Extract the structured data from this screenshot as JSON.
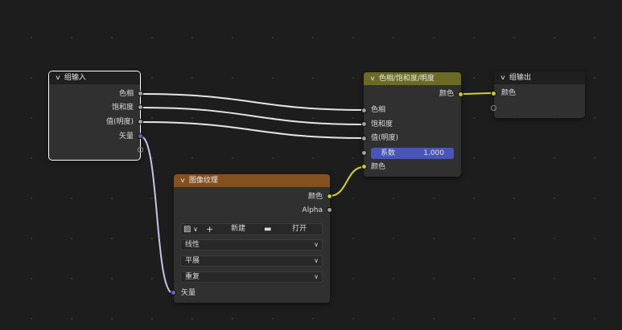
{
  "nodes": {
    "group_input": {
      "title": "组输入",
      "outputs": [
        "色相",
        "饱和度",
        "值(明度)",
        "矢量"
      ]
    },
    "hsv": {
      "title": "色相/饱和度/明度",
      "output": "颜色",
      "inputs": [
        "色相",
        "饱和度",
        "值(明度)"
      ],
      "factor_label": "系数",
      "factor_value": "1.000",
      "color_input": "颜色"
    },
    "group_output": {
      "title": "组输出",
      "input": "颜色"
    },
    "image_texture": {
      "title": "图像纹理",
      "outputs": [
        "颜色",
        "Alpha"
      ],
      "new_label": "新建",
      "open_label": "打开",
      "interpolation": "线性",
      "projection": "平展",
      "extension": "重复",
      "vector_input": "矢量"
    }
  },
  "colors": {
    "hsv_header": "#6b6b25",
    "image_header": "#83501f",
    "group_header": "#1f1f1f",
    "socket_color": "#c7c729",
    "socket_float": "#a1a1a1",
    "socket_vector": "#6363c7"
  }
}
